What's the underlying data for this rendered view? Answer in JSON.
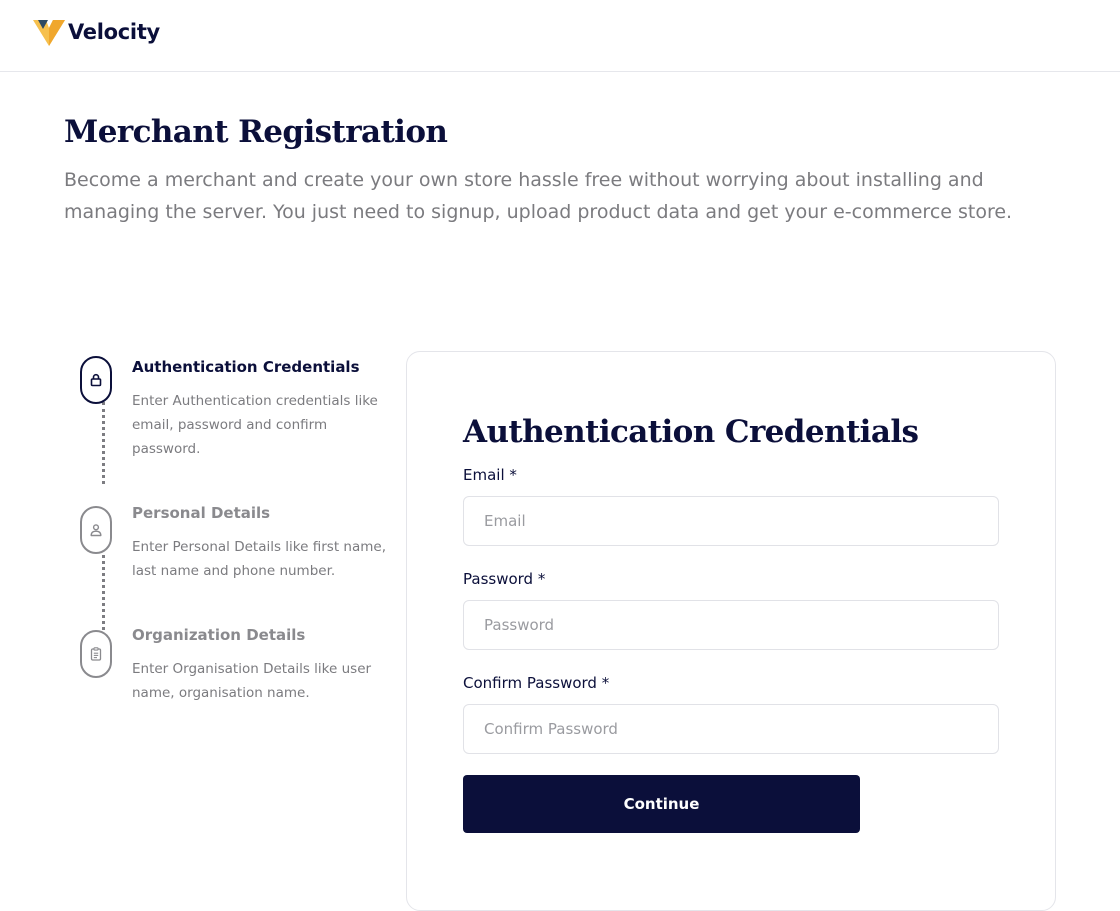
{
  "header": {
    "brand_name": "Velocity",
    "logo_colors": {
      "light": "#f6c04d",
      "main": "#f0a72d",
      "dark": "#2e4a63"
    }
  },
  "page": {
    "title": "Merchant Registration",
    "description": "Become a merchant and create your own store hassle free without worrying about installing and managing the server. You just need to signup, upload product data and get your e-commerce store."
  },
  "steps": [
    {
      "title": "Authentication Credentials",
      "description": "Enter Authentication credentials like email, password and confirm password.",
      "icon": "lock-icon",
      "active": true
    },
    {
      "title": "Personal Details",
      "description": "Enter Personal Details like first name, last name and phone number.",
      "icon": "user-icon",
      "active": false
    },
    {
      "title": "Organization Details",
      "description": "Enter Organisation Details like user name, organisation name.",
      "icon": "clipboard-icon",
      "active": false
    }
  ],
  "form": {
    "title": "Authentication Credentials",
    "email": {
      "label": "Email *",
      "placeholder": "Email",
      "value": ""
    },
    "password": {
      "label": "Password *",
      "placeholder": "Password",
      "value": ""
    },
    "confirm_password": {
      "label": "Confirm Password *",
      "placeholder": "Confirm Password",
      "value": ""
    },
    "continue_label": "Continue"
  },
  "colors": {
    "primary": "#0b0f3a",
    "muted_text": "#7b7b7f",
    "border": "#e1e2e7"
  }
}
